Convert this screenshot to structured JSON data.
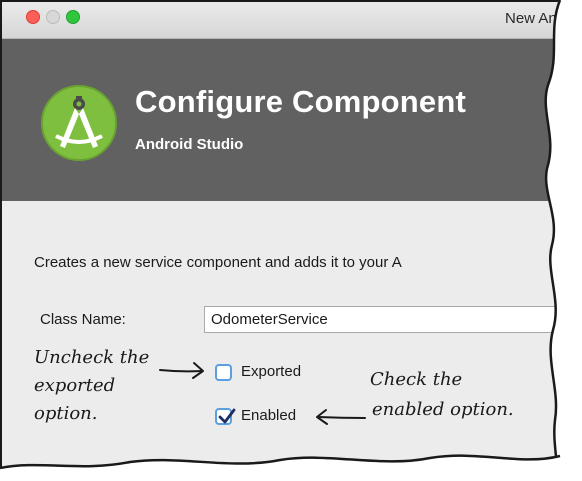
{
  "window": {
    "title": "New An"
  },
  "header": {
    "title": "Configure Component",
    "subtitle": "Android Studio"
  },
  "form": {
    "description": "Creates a new service component and adds it to your A",
    "class_name_label": "Class Name:",
    "class_name_value": "OdometerService",
    "exported": {
      "label": "Exported",
      "checked": false
    },
    "enabled": {
      "label": "Enabled",
      "checked": true
    }
  },
  "annotations": {
    "uncheck_line1": "Uncheck the",
    "uncheck_line2": "exported",
    "uncheck_line3": "option.",
    "check_line1": "Check the",
    "check_line2": "enabled option."
  },
  "colors": {
    "header_bg": "#616161",
    "body_bg": "#ececec",
    "checkbox_blue": "#5a9fe0",
    "logo_green": "#a4c639"
  },
  "icons": {
    "logo": "android-studio-logo-icon",
    "checkbox_checked": "checkmark-icon"
  }
}
